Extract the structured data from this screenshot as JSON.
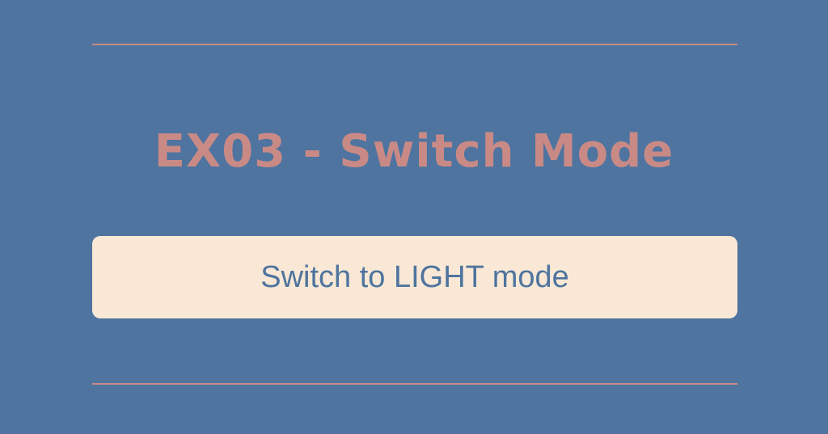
{
  "page": {
    "title": "EX03 - Switch Mode"
  },
  "switch": {
    "label": "Switch to LIGHT mode"
  },
  "colors": {
    "background": "#4e749f",
    "accent": "#c98a86",
    "button_background": "#f9e8d5",
    "button_text": "#4e749f"
  }
}
